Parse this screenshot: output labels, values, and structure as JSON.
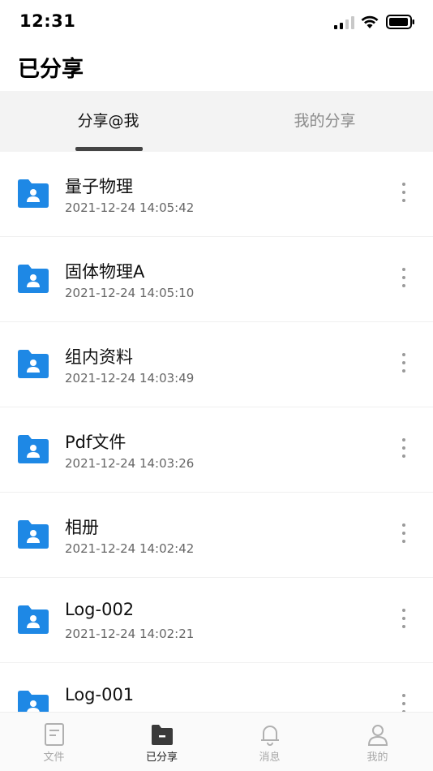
{
  "status_bar": {
    "time": "12:31"
  },
  "header": {
    "title": "已分享"
  },
  "tabs": [
    {
      "label": "分享@我",
      "active": true
    },
    {
      "label": "我的分享",
      "active": false
    }
  ],
  "files": [
    {
      "name": "量子物理",
      "date": "2021-12-24 14:05:42"
    },
    {
      "name": "固体物理A",
      "date": "2021-12-24 14:05:10"
    },
    {
      "name": "组内资料",
      "date": "2021-12-24 14:03:49"
    },
    {
      "name": "Pdf文件",
      "date": "2021-12-24 14:03:26"
    },
    {
      "name": "相册",
      "date": "2021-12-24 14:02:42"
    },
    {
      "name": "Log-002",
      "date": "2021-12-24 14:02:21"
    },
    {
      "name": "Log-001",
      "date": ""
    }
  ],
  "bottom_nav": [
    {
      "label": "文件",
      "icon": "document-icon",
      "active": false
    },
    {
      "label": "已分享",
      "icon": "shared-folder-icon",
      "active": true
    },
    {
      "label": "消息",
      "icon": "bell-icon",
      "active": false
    },
    {
      "label": "我的",
      "icon": "person-icon",
      "active": false
    }
  ],
  "colors": {
    "folder_blue": "#1e88e5",
    "indicator": "#444444",
    "tab_bg": "#f3f3f3"
  }
}
